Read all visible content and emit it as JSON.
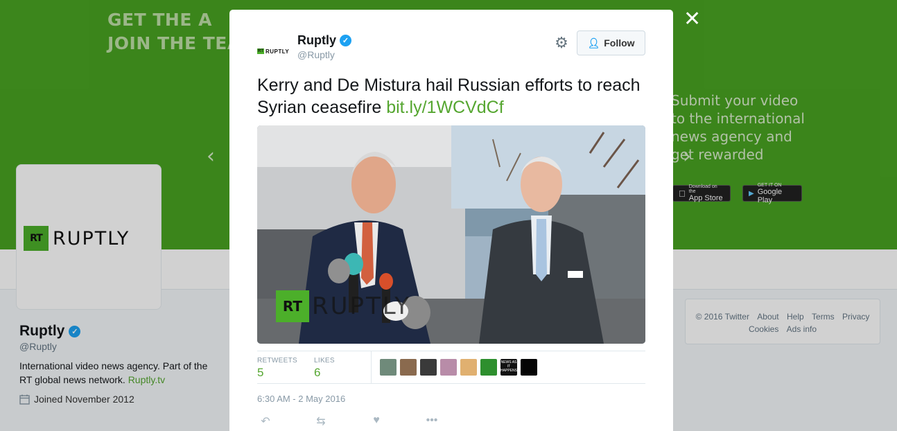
{
  "banner": {
    "headline_line1": "GET THE A",
    "headline_line2": "JOIN THE TEA",
    "subtext_line1": "Submit your video",
    "subtext_line2": "to the international",
    "subtext_line3": "news agency and",
    "subtext_line4": "get rewarded",
    "app_store_small": "Download on the",
    "app_store": "App Store",
    "google_play_small": "GET IT ON",
    "google_play": "Google Play"
  },
  "profile": {
    "logo_rt": "RT",
    "logo_word": "RUPTLY",
    "name": "Ruptly",
    "handle": "@Ruptly",
    "bio": "International video news agency. Part of the RT global news network.",
    "bio_link": "Ruptly.tv",
    "joined": "Joined November 2012"
  },
  "footer": {
    "links": [
      "© 2016 Twitter",
      "About",
      "Help",
      "Terms",
      "Privacy",
      "Cookies",
      "Ads info"
    ]
  },
  "modal": {
    "close": "✕",
    "author_name": "Ruptly",
    "author_handle": "@Ruptly",
    "avatar_rt": "RT",
    "avatar_word": "RUPTLY",
    "follow_label": "Follow",
    "tweet_text": "Kerry and De Mistura hail Russian efforts to reach Syrian ceasefire ",
    "tweet_link": "bit.ly/1WCVdCf",
    "media_watermark_rt": "RT",
    "media_watermark_word": "RUPTLY",
    "retweets_label": "RETWEETS",
    "retweets_count": "5",
    "likes_label": "LIKES",
    "likes_count": "6",
    "timestamp": "6:30 AM - 2 May 2016",
    "liker_colors": [
      "#6f8a7a",
      "#8a6a4e",
      "#3a3a3a",
      "#b88ca8",
      "#e0b070",
      "#2e8f2e",
      "#111111",
      "#050505"
    ],
    "liker_labels": [
      "",
      "",
      "",
      "",
      "",
      "",
      "NEWS AS IT HAPPENS",
      ""
    ]
  },
  "colors": {
    "banner_green": "#49a322",
    "link_green": "#55a630",
    "verified_blue": "#1da1f2"
  }
}
